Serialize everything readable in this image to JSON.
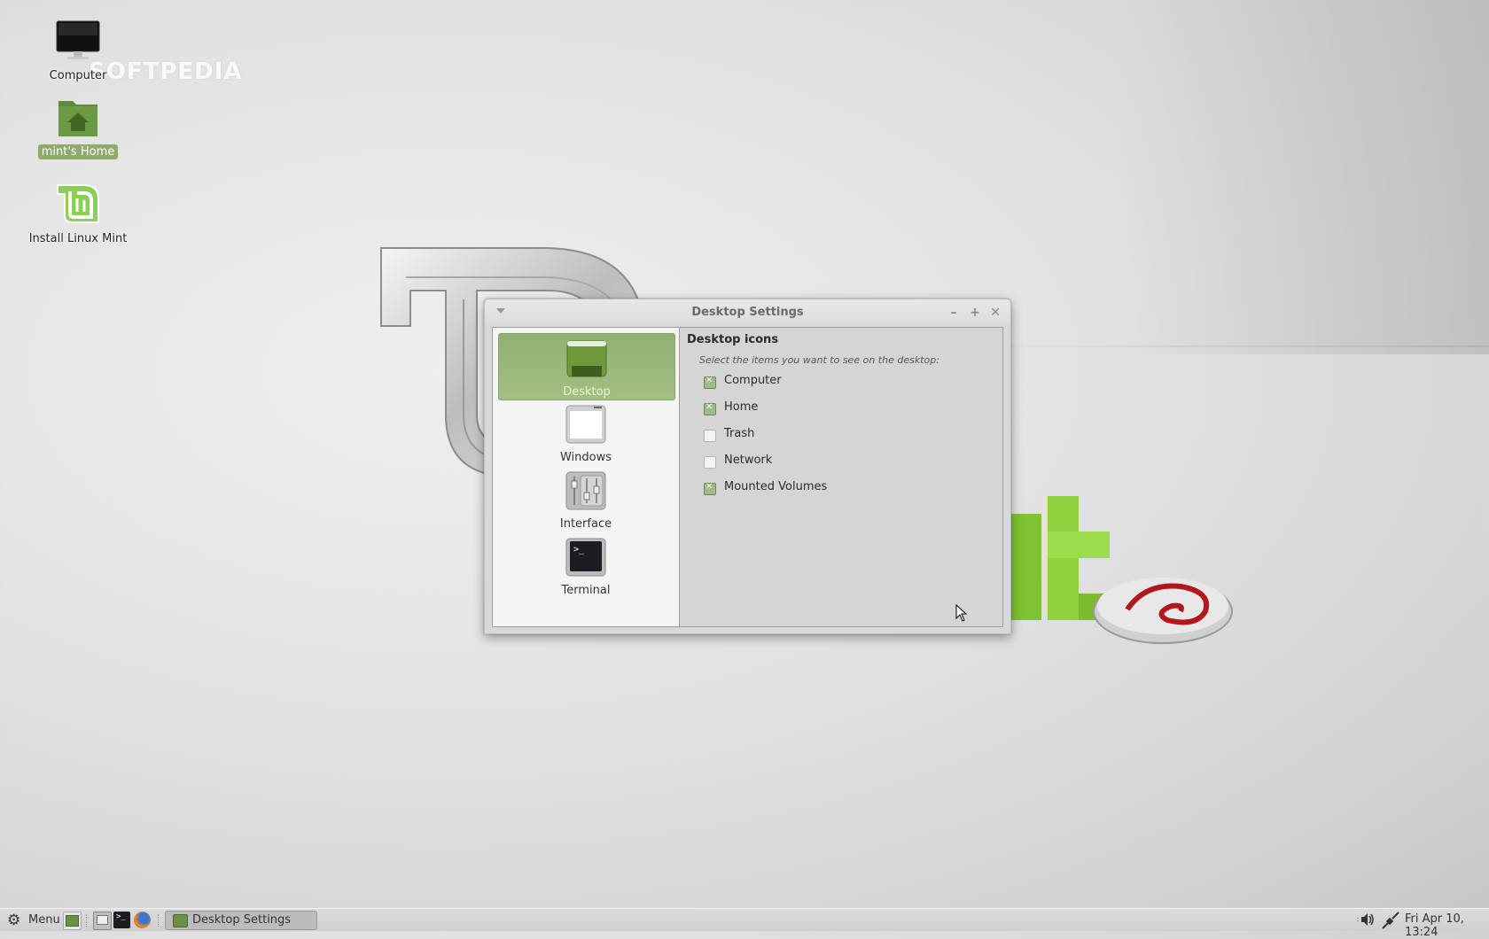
{
  "watermark": "SOFTPEDIA",
  "desktop_icons": [
    {
      "label": "Computer",
      "icon": "monitor-icon",
      "selected": false
    },
    {
      "label": "mint's Home",
      "icon": "home-folder-icon",
      "selected": true
    },
    {
      "label": "Install Linux Mint",
      "icon": "linux-mint-logo-icon",
      "selected": false
    }
  ],
  "dialog": {
    "title": "Desktop Settings",
    "window_controls": {
      "minimize": "–",
      "maximize": "+",
      "close": "✕"
    },
    "sidebar": [
      {
        "label": "Desktop",
        "icon": "desktop-icon",
        "active": true
      },
      {
        "label": "Windows",
        "icon": "windows-icon",
        "active": false
      },
      {
        "label": "Interface",
        "icon": "interface-sliders-icon",
        "active": false
      },
      {
        "label": "Terminal",
        "icon": "terminal-icon",
        "active": false
      }
    ],
    "content": {
      "heading": "Desktop icons",
      "hint": "Select the items you want to see on the desktop:",
      "options": [
        {
          "label": "Computer",
          "checked": true
        },
        {
          "label": "Home",
          "checked": true
        },
        {
          "label": "Trash",
          "checked": false
        },
        {
          "label": "Network",
          "checked": false
        },
        {
          "label": "Mounted Volumes",
          "checked": true
        }
      ]
    }
  },
  "taskbar": {
    "menu_label": "Menu",
    "launchers": [
      "show-desktop-icon",
      "file-manager-icon",
      "terminal-icon",
      "firefox-icon"
    ],
    "tasks": [
      {
        "label": "Desktop Settings"
      }
    ],
    "clock": "Fri Apr 10, 13:24"
  },
  "colors": {
    "accent_green": "#8dab6a",
    "checkbox_checked": "#9fb987"
  }
}
